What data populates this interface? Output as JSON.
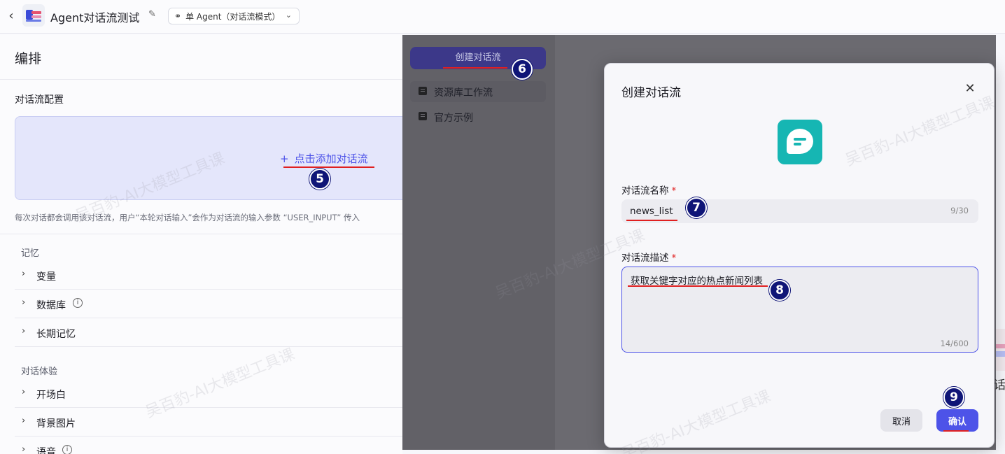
{
  "header": {
    "back_glyph": "‹",
    "app_title": "Agent对话流测试",
    "edit_glyph": "✎",
    "mode_icon_glyph": "⚭",
    "mode": "单 Agent（对话流模式）",
    "mode_chevron": "⌄"
  },
  "left_panel": {
    "title": "编排",
    "dialog_flow_config_label": "对话流配置",
    "add_flow_plus": "+",
    "add_flow_label": "点击添加对话流",
    "hint": "每次对话都会调用该对话流，用户“本轮对话输入”会作为对话流的输入参数 “USER_INPUT” 传入",
    "memory_group": "记忆",
    "memory_items": [
      "变量",
      "数据库",
      "长期记忆"
    ],
    "experience_group": "对话体验",
    "experience_items": [
      "开场白",
      "背景图片",
      "语音"
    ],
    "chevron": "›",
    "info_glyph": "i"
  },
  "side_menu": {
    "create_button": "创建对话流",
    "items": [
      "资源库工作流",
      "官方示例"
    ]
  },
  "modal": {
    "title": "创建对话流",
    "close_glyph": "✕",
    "name_label": "对话流名称",
    "required_mark": "*",
    "name_value": "news_list",
    "name_count": "9/30",
    "desc_label": "对话流描述",
    "desc_value": "获取关键字对应的热点新闻列表",
    "desc_count": "14/600",
    "cancel_label": "取消",
    "confirm_label": "确认"
  },
  "annotations": {
    "step5": "5",
    "step6": "6",
    "step7": "7",
    "step8": "8",
    "step9": "9"
  },
  "watermark": "吴百豹-AI大模型工具课",
  "edge_text": "话",
  "colors": {
    "accent": "#4d53e8",
    "flow_icon": "#16b6b3",
    "badge": "#0f1577",
    "annotation_line": "#e02020"
  }
}
